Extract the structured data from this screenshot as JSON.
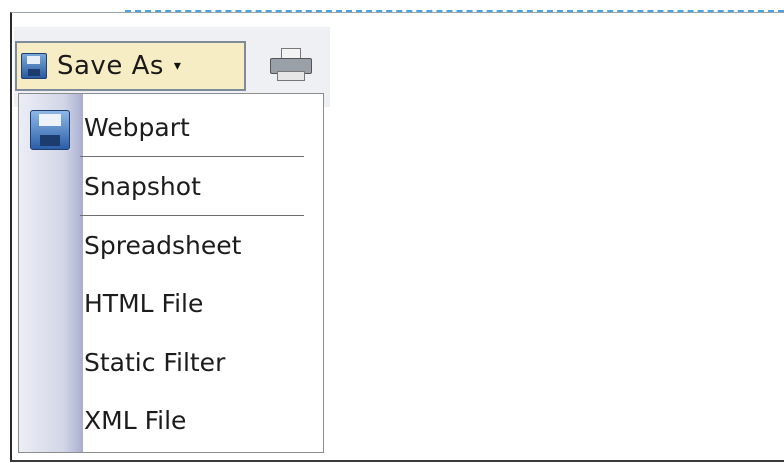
{
  "toolbar": {
    "save_as_label": "Save As",
    "caret": "▾"
  },
  "menu": {
    "items": [
      {
        "label": "Webpart"
      },
      {
        "label": "Snapshot"
      },
      {
        "label": "Spreadsheet"
      },
      {
        "label": "HTML File"
      },
      {
        "label": "Static Filter"
      },
      {
        "label": "XML File"
      }
    ]
  },
  "icons": {
    "save": "floppy-disk-icon",
    "print": "printer-icon"
  },
  "colors": {
    "button_bg": "#f6edc4",
    "accent_dashed": "#4aa3df"
  }
}
